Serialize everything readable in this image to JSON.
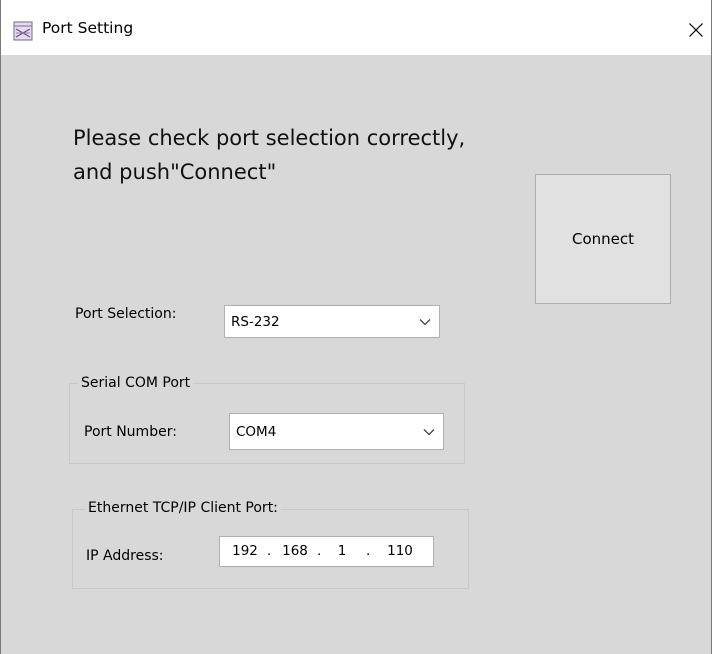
{
  "window": {
    "title": "Port Setting",
    "app_icon": "app-icon",
    "close_glyph": "✕"
  },
  "main": {
    "instructions": "Please check port selection correctly, and push\"Connect\"",
    "connect_label": "Connect",
    "port_selection": {
      "label": "Port Selection:",
      "value": "RS-232"
    },
    "serial_group": {
      "title": "Serial COM Port",
      "port_number_label": "Port Number:",
      "port_number_value": "COM4"
    },
    "ethernet_group": {
      "title": "Ethernet TCP/IP Client Port:",
      "ip_label": "IP Address:",
      "ip_octets": [
        "192",
        "168",
        "1",
        "110"
      ],
      "separator": "."
    }
  },
  "colors": {
    "window_bg": "#d8d8d8",
    "titlebar_bg": "#ffffff",
    "button_bg": "#e1e1e1",
    "field_bg": "#ffffff",
    "border": "#adadad"
  }
}
